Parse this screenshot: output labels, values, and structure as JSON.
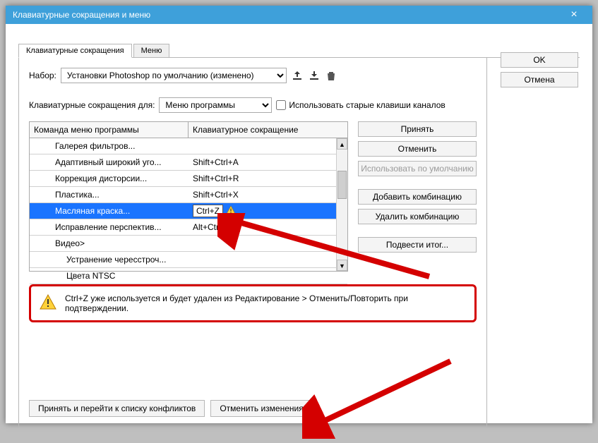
{
  "title": "Клавиатурные сокращения и меню",
  "right": {
    "ok": "OK",
    "cancel": "Отмена"
  },
  "tabs": {
    "shortcuts": "Клавиатурные сокращения",
    "menus": "Меню"
  },
  "set_label": "Набор:",
  "set_value": "Установки Photoshop по умолчанию (изменено)",
  "for_label": "Клавиатурные сокращения для:",
  "for_value": "Меню программы",
  "legacy_check": "Использовать старые клавиши каналов",
  "cols": {
    "cmd": "Команда меню программы",
    "sc": "Клавиатурное сокращение"
  },
  "side": {
    "accept": "Принять",
    "undo": "Отменить",
    "default": "Использовать по умолчанию",
    "add": "Добавить комбинацию",
    "del": "Удалить комбинацию",
    "sum": "Подвести итог..."
  },
  "rows": [
    {
      "label": "Галерея фильтров...",
      "sc": "",
      "indent": 1
    },
    {
      "label": "Адаптивный широкий уго...",
      "sc": "Shift+Ctrl+A",
      "indent": 1
    },
    {
      "label": "Коррекция дисторсии...",
      "sc": "Shift+Ctrl+R",
      "indent": 1
    },
    {
      "label": "Пластика...",
      "sc": "Shift+Ctrl+X",
      "indent": 1
    },
    {
      "label": "Масляная краска...",
      "sc": "Ctrl+Z",
      "indent": 1,
      "selected": true,
      "warn": true
    },
    {
      "label": "Исправление перспектив...",
      "sc": "Alt+Ctrl+V",
      "indent": 1
    },
    {
      "label": "Видео>",
      "sc": "",
      "indent": 1
    },
    {
      "label": "Устранение чересстроч...",
      "sc": "",
      "indent": 2
    },
    {
      "label": "Цвета NTSC",
      "sc": "",
      "indent": 2
    }
  ],
  "warn_text": "Ctrl+Z уже используется и будет удален из Редактирование > Отменить/Повторить при подтверждении.",
  "foot": {
    "conflicts": "Принять и перейти к списку конфликтов",
    "cancel": "Отменить изменения"
  }
}
